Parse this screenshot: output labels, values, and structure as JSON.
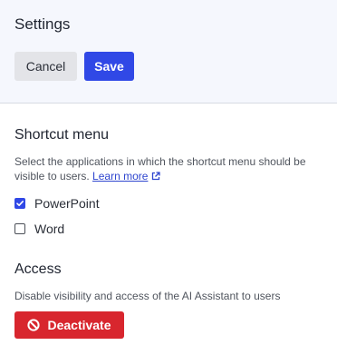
{
  "header": {
    "title": "Settings",
    "cancel_label": "Cancel",
    "save_label": "Save"
  },
  "shortcut_menu": {
    "title": "Shortcut menu",
    "description": "Select the applications in which the shortcut menu should be visible to users.",
    "learn_more_label": "Learn more",
    "learn_more_icon": "external-link-icon",
    "options": [
      {
        "label": "PowerPoint",
        "checked": true
      },
      {
        "label": "Word",
        "checked": false
      }
    ]
  },
  "access": {
    "title": "Access",
    "description": "Disable visibility and access of the AI Assistant to users",
    "deactivate_label": "Deactivate",
    "deactivate_icon": "ban-icon"
  },
  "colors": {
    "header_bg": "#f5f7fd",
    "primary": "#3048e6",
    "danger": "#d8262e",
    "link": "#2f46cf"
  }
}
